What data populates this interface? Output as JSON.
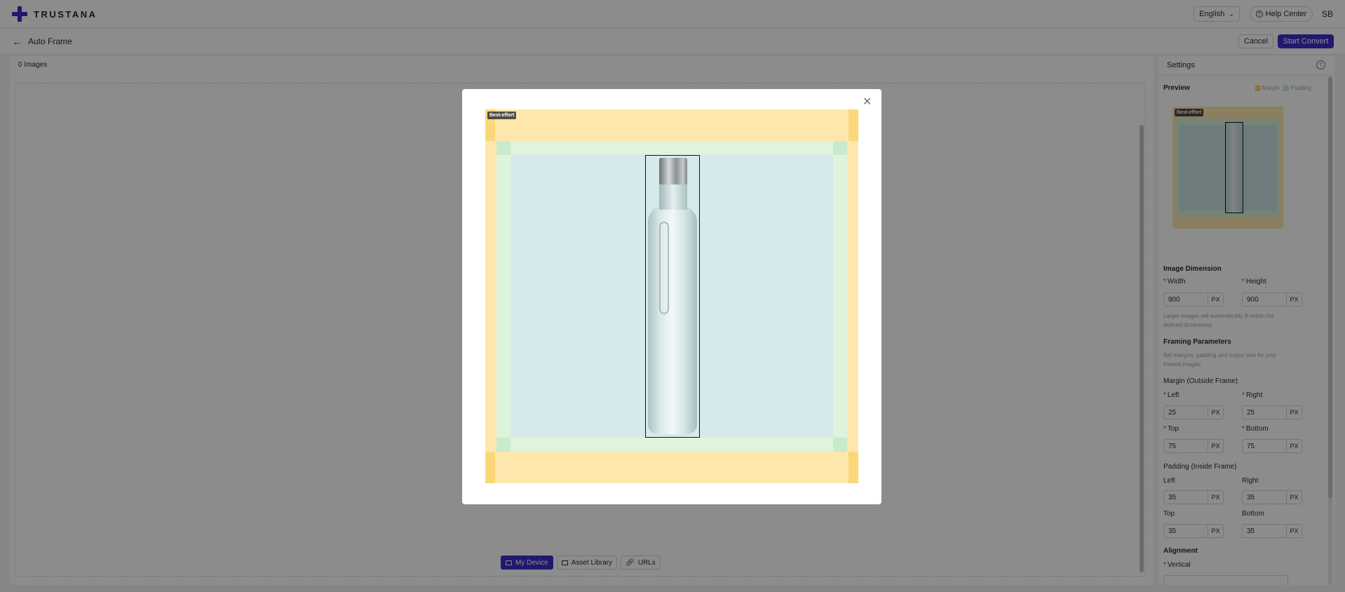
{
  "app": {
    "logo_text": "TRUSTANA"
  },
  "topbar": {
    "language": "English",
    "help_center": "Help Center",
    "avatar_initials": "SB"
  },
  "subheader": {
    "title": "Auto Frame",
    "cancel_label": "Cancel",
    "start_convert_label": "Start Convert"
  },
  "main": {
    "images_count": "0 Images",
    "sources": [
      {
        "label": "My Device",
        "active": true
      },
      {
        "label": "Asset Library",
        "active": false
      },
      {
        "label": "URLs",
        "active": false
      }
    ]
  },
  "settings": {
    "title": "Settings",
    "preview_label": "Preview",
    "legend": {
      "margin": "Margin",
      "padding": "Padding"
    },
    "preview_tag": "Best-effort",
    "image_dimension": {
      "title": "Image Dimension",
      "width_label": "Width",
      "width_value": "900",
      "height_label": "Height",
      "height_value": "900",
      "unit": "PX",
      "hint": "Larger images will automatically fit within the defined dimensions."
    },
    "framing": {
      "title": "Framing Parameters",
      "hint": "Set margins, padding and output size for your framed images."
    },
    "margin": {
      "title": "Margin (Outside Frame)",
      "left_label": "Left",
      "left_value": "25",
      "right_label": "Right",
      "right_value": "25",
      "top_label": "Top",
      "top_value": "75",
      "bottom_label": "Bottom",
      "bottom_value": "75"
    },
    "padding": {
      "title": "Padding (Inside Frame)",
      "left_label": "Left",
      "left_value": "35",
      "right_label": "Right",
      "right_value": "35",
      "top_label": "Top",
      "top_value": "35",
      "bottom_label": "Bottom",
      "bottom_value": "35"
    },
    "alignment": {
      "title": "Alignment",
      "vertical_label": "Vertical"
    }
  },
  "modal": {
    "tag": "Best-effort"
  },
  "colors": {
    "brand": "#3b2fc9",
    "margin": "#fde7ad",
    "padding": "#dff4dc",
    "content": "#d6eaec"
  }
}
